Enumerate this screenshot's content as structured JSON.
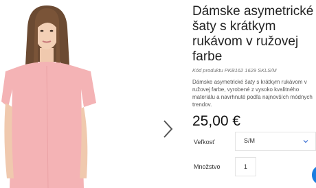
{
  "product": {
    "title": "Dámske asymetrické šaty s krátkym rukávom v ružovej farbe",
    "code": "Kód produktu PKB162 1629 SKLS/M",
    "description": "Dámske asymetrické šaty s krátkym rukávom v ružovej farbe, vyrobené z vysoko kvalitného materiálu a navrhnuté podľa najnovších módnych trendov.",
    "price": "25,00 €",
    "size_label": "Veľkosť",
    "size_value": "S/M",
    "quantity_label": "Množstvo",
    "quantity_value": "1"
  },
  "icons": {
    "gallery_next": "chevron-right-icon",
    "size_dropdown": "chevron-down-icon",
    "chat": "chat-icon"
  },
  "colors": {
    "dress": "#f4b3b5",
    "accent": "#1b7ee0"
  }
}
